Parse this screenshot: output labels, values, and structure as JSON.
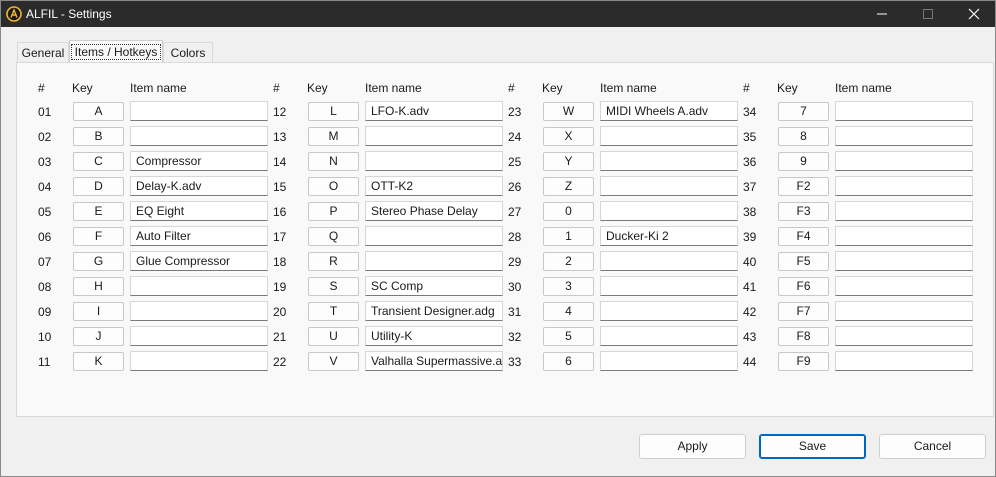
{
  "window": {
    "title": "ALFIL - Settings",
    "logo_icon": "alfil-logo-icon",
    "controls": [
      "minimize-icon",
      "maximize-icon",
      "close-icon"
    ]
  },
  "tabs": [
    {
      "label": "General",
      "active": false
    },
    {
      "label": "Items / Hotkeys",
      "active": true
    },
    {
      "label": "Colors",
      "active": false
    }
  ],
  "columns": {
    "num_header": "#",
    "key_header": "Key",
    "name_header": "Item name"
  },
  "items": [
    {
      "num": "01",
      "key": "A",
      "name": ""
    },
    {
      "num": "02",
      "key": "B",
      "name": ""
    },
    {
      "num": "03",
      "key": "C",
      "name": "Compressor"
    },
    {
      "num": "04",
      "key": "D",
      "name": "Delay-K.adv"
    },
    {
      "num": "05",
      "key": "E",
      "name": "EQ Eight"
    },
    {
      "num": "06",
      "key": "F",
      "name": "Auto Filter"
    },
    {
      "num": "07",
      "key": "G",
      "name": "Glue Compressor"
    },
    {
      "num": "08",
      "key": "H",
      "name": ""
    },
    {
      "num": "09",
      "key": "I",
      "name": ""
    },
    {
      "num": "10",
      "key": "J",
      "name": ""
    },
    {
      "num": "11",
      "key": "K",
      "name": ""
    },
    {
      "num": "12",
      "key": "L",
      "name": "LFO-K.adv"
    },
    {
      "num": "13",
      "key": "M",
      "name": ""
    },
    {
      "num": "14",
      "key": "N",
      "name": ""
    },
    {
      "num": "15",
      "key": "O",
      "name": "OTT-K2"
    },
    {
      "num": "16",
      "key": "P",
      "name": "Stereo Phase Delay"
    },
    {
      "num": "17",
      "key": "Q",
      "name": ""
    },
    {
      "num": "18",
      "key": "R",
      "name": ""
    },
    {
      "num": "19",
      "key": "S",
      "name": "SC Comp"
    },
    {
      "num": "20",
      "key": "T",
      "name": "Transient Designer.adg"
    },
    {
      "num": "21",
      "key": "U",
      "name": "Utility-K"
    },
    {
      "num": "22",
      "key": "V",
      "name": "Valhalla Supermassive.adv"
    },
    {
      "num": "23",
      "key": "W",
      "name": "MIDI Wheels A.adv"
    },
    {
      "num": "24",
      "key": "X",
      "name": ""
    },
    {
      "num": "25",
      "key": "Y",
      "name": ""
    },
    {
      "num": "26",
      "key": "Z",
      "name": ""
    },
    {
      "num": "27",
      "key": "0",
      "name": ""
    },
    {
      "num": "28",
      "key": "1",
      "name": "Ducker-Ki 2"
    },
    {
      "num": "29",
      "key": "2",
      "name": ""
    },
    {
      "num": "30",
      "key": "3",
      "name": ""
    },
    {
      "num": "31",
      "key": "4",
      "name": ""
    },
    {
      "num": "32",
      "key": "5",
      "name": ""
    },
    {
      "num": "33",
      "key": "6",
      "name": ""
    },
    {
      "num": "34",
      "key": "7",
      "name": ""
    },
    {
      "num": "35",
      "key": "8",
      "name": ""
    },
    {
      "num": "36",
      "key": "9",
      "name": ""
    },
    {
      "num": "37",
      "key": "F2",
      "name": ""
    },
    {
      "num": "38",
      "key": "F3",
      "name": ""
    },
    {
      "num": "39",
      "key": "F4",
      "name": ""
    },
    {
      "num": "40",
      "key": "F5",
      "name": ""
    },
    {
      "num": "41",
      "key": "F6",
      "name": ""
    },
    {
      "num": "42",
      "key": "F7",
      "name": ""
    },
    {
      "num": "43",
      "key": "F8",
      "name": ""
    },
    {
      "num": "44",
      "key": "F9",
      "name": ""
    }
  ],
  "buttons": {
    "apply": "Apply",
    "save": "Save",
    "cancel": "Cancel"
  },
  "colors": {
    "titlebar": "#2b2b2b",
    "logo_ring": "#f2b632",
    "default_button_border": "#0067c0"
  }
}
